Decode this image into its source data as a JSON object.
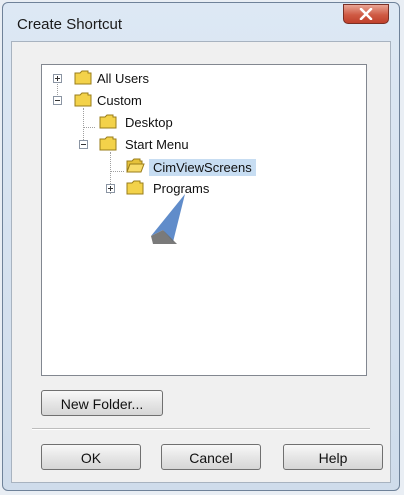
{
  "window": {
    "title": "Create Shortcut"
  },
  "tree": {
    "items": [
      {
        "label": "All Users",
        "expander": "plus"
      },
      {
        "label": "Custom",
        "expander": "minus"
      },
      {
        "label": "Desktop",
        "expander": "none"
      },
      {
        "label": "Start Menu",
        "expander": "minus"
      },
      {
        "label": "CimViewScreens",
        "expander": "none",
        "selected": true
      },
      {
        "label": "Programs",
        "expander": "plus"
      }
    ]
  },
  "buttons": {
    "new_folder": "New Folder...",
    "ok": "OK",
    "cancel": "Cancel",
    "help": "Help"
  },
  "colors": {
    "selection": "#c7ddf2",
    "folder": "#f3d24a",
    "close": "#cf5a44",
    "cursor": "#4f7fc4"
  }
}
